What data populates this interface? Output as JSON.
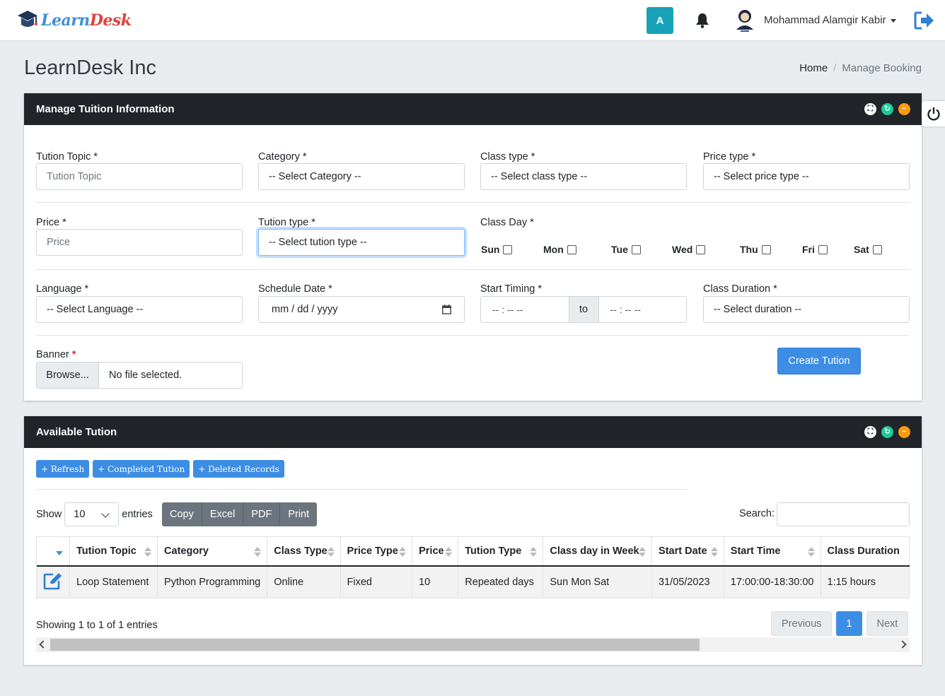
{
  "header": {
    "logo_part1": "Learn",
    "logo_part2": "Desk",
    "avatar_letter": "A",
    "user_name": "Mohammad Alamgir Kabir"
  },
  "page": {
    "title": "LearnDesk Inc",
    "breadcrumb_home": "Home",
    "breadcrumb_current": "Manage Booking"
  },
  "form_card": {
    "title": "Manage Tuition Information",
    "fields": {
      "tution_topic": {
        "label": "Tution Topic *",
        "placeholder": "Tution Topic"
      },
      "category": {
        "label": "Category *",
        "value": "-- Select Category --"
      },
      "class_type": {
        "label": "Class type *",
        "value": "-- Select class type --"
      },
      "price_type": {
        "label": "Price type *",
        "value": "-- Select price type --"
      },
      "price": {
        "label": "Price *",
        "placeholder": "Price"
      },
      "tution_type": {
        "label": "Tution type *",
        "value": "-- Select tution type --"
      },
      "class_day": {
        "label": "Class Day *"
      },
      "language": {
        "label": "Language *",
        "value": "-- Select Language --"
      },
      "schedule_date": {
        "label": "Schedule Date *",
        "value": "mm / dd / yyyy"
      },
      "start_timing": {
        "label": "Start Timing *",
        "from": "-- : --  --",
        "to_label": "to",
        "to": "-- : --  --"
      },
      "class_duration": {
        "label": "Class Duration *",
        "value": "-- Select duration --"
      },
      "banner": {
        "label": "Banner ",
        "required_mark": "*",
        "browse": "Browse...",
        "file_text": "No file selected."
      }
    },
    "days": [
      "Sun",
      "Mon",
      "Tue",
      "Wed",
      "Thu",
      "Fri",
      "Sat"
    ],
    "submit_label": "Create Tution"
  },
  "table_card": {
    "title": "Available Tution",
    "buttons": [
      "+ Refresh",
      "+ Completed Tution",
      "+ Deleted Records"
    ],
    "show_label": "Show",
    "page_length": "10",
    "entries_label": "entries",
    "export_buttons": [
      "Copy",
      "Excel",
      "PDF",
      "Print"
    ],
    "search_label": "Search:",
    "columns": [
      "Tution Topic",
      "Category",
      "Class Type",
      "Price Type",
      "Price",
      "Tution Type",
      "Class day in Week",
      "Start Date",
      "Start Time",
      "Class Duration"
    ],
    "rows": [
      [
        "Loop Statement",
        "Python Programming",
        "Online",
        "Fixed",
        "10",
        "Repeated days",
        "Sun Mon Sat",
        "31/05/2023",
        "17:00:00-18:30:00",
        "1:15 hours"
      ]
    ],
    "info": "Showing 1 to 1 of 1 entries",
    "pager": {
      "prev": "Previous",
      "page": "1",
      "next": "Next"
    }
  },
  "colors": {
    "navbar_bg": "#ffffff",
    "card_header_bg": "#212529",
    "primary": "#3d8de4",
    "avatar_teal": "#17a2b8",
    "export_gray": "#6c757d"
  }
}
